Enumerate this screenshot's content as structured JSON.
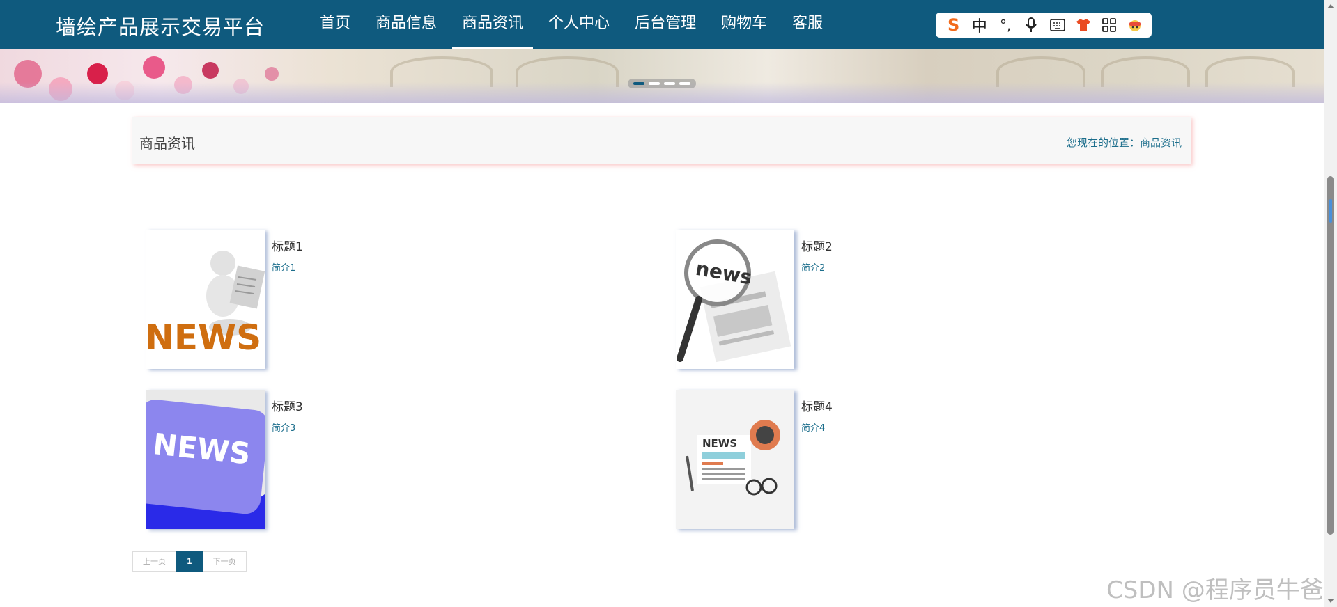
{
  "site": {
    "logo": "墙绘产品展示交易平台"
  },
  "nav": [
    {
      "label": "首页"
    },
    {
      "label": "商品信息"
    },
    {
      "label": "商品资讯",
      "active": true
    },
    {
      "label": "个人中心"
    },
    {
      "label": "后台管理"
    },
    {
      "label": "购物车"
    },
    {
      "label": "客服"
    }
  ],
  "ime": {
    "mode": "中",
    "punct": "°,",
    "icons": [
      "sogou-logo-icon",
      "microphone-icon",
      "keyboard-icon",
      "shirt-icon",
      "grid-icon",
      "face-icon"
    ]
  },
  "banner": {
    "slides": 4,
    "active_slide": 1
  },
  "section": {
    "title": "商品资讯",
    "location_label": "您现在的位置：",
    "location_value": "商品资讯"
  },
  "news": [
    {
      "title": "标题1",
      "intro": "简介1",
      "image": "news-man-reading-image"
    },
    {
      "title": "标题2",
      "intro": "简介2",
      "image": "news-magnifier-image"
    },
    {
      "title": "标题3",
      "intro": "简介3",
      "image": "news-keyboard-key-image"
    },
    {
      "title": "标题4",
      "intro": "简介4",
      "image": "news-flat-desk-image"
    }
  ],
  "pagination": {
    "prev": "上一页",
    "current": "1",
    "next": "下一页"
  },
  "watermark": "CSDN @程序员牛爸",
  "colors": {
    "primary": "#0f5a7e",
    "link": "#1c6e8c"
  }
}
